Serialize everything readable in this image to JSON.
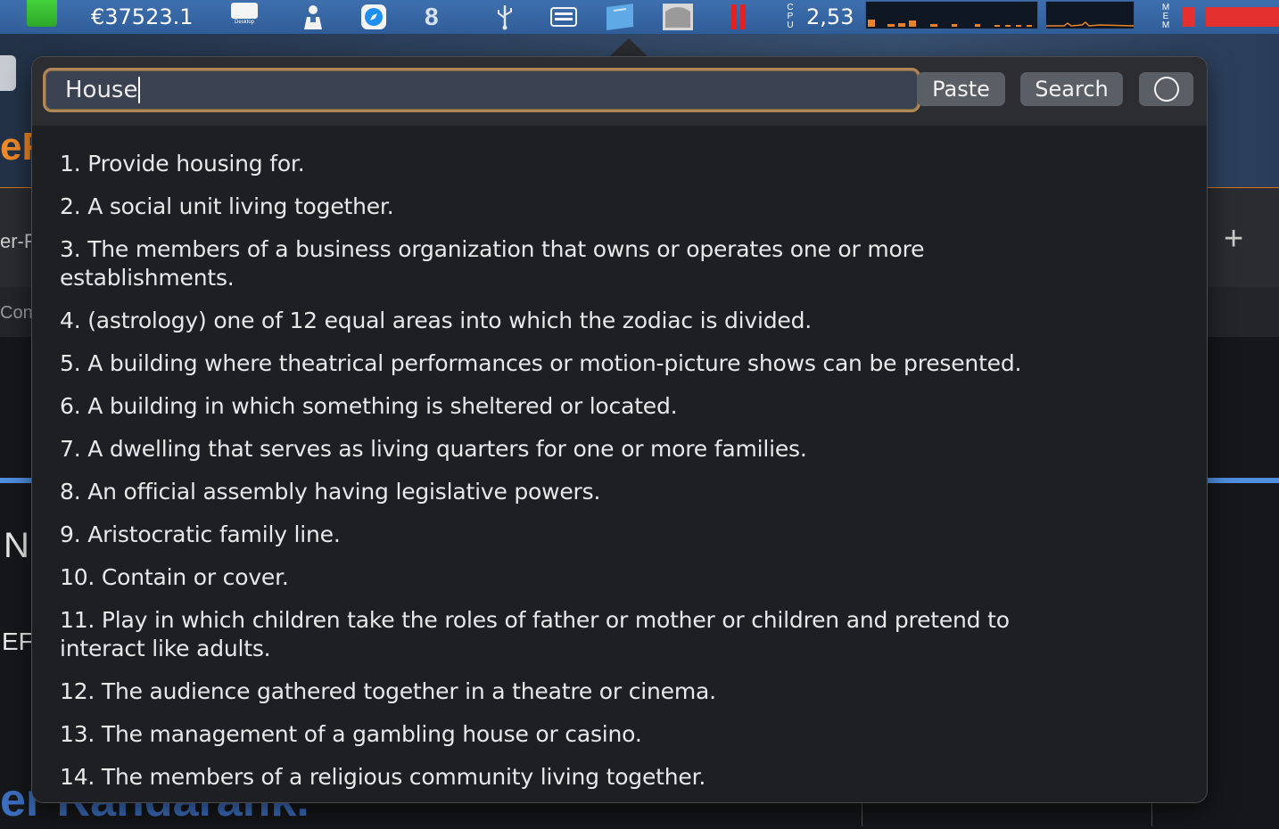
{
  "menubar": {
    "price": "€37523.1",
    "desktop_label": "Desktop",
    "cpu_label": [
      "C",
      "P",
      "U"
    ],
    "cpu_value": "2,53",
    "mem_label": [
      "M",
      "E",
      "M"
    ],
    "icons": [
      "battery-icon",
      "desktop-icon",
      "person-icon",
      "safari-icon",
      "eight-icon",
      "usb-icon",
      "keyboard-icon",
      "finder-icon",
      "disk-icon",
      "activity-bars-icon"
    ]
  },
  "background": {
    "left_e": "eF",
    "tab_fragment": "er-F",
    "con_fragment": "Con",
    "n_fragment": "N",
    "ep_fragment": "EF",
    "bottom_fragment": "er Randarank.",
    "plus": "+"
  },
  "popover": {
    "query": "House",
    "paste_label": "Paste",
    "search_label": "Search",
    "definitions": [
      "1. Provide housing for.",
      "2. A social unit living together.",
      "3. The members of a business organization that owns or operates one or more establishments.",
      "4. (astrology) one of 12 equal areas into which the zodiac is divided.",
      "5. A building where theatrical performances or motion-picture shows can be presented.",
      "6. A building in which something is sheltered or located.",
      "7. A dwelling that serves as living quarters for one or more families.",
      "8. An official assembly having legislative powers.",
      "9. Aristocratic family line.",
      "10. Contain or cover.",
      "11. Play in which children take the roles of father or mother or children and pretend to interact like adults.",
      "12. The audience gathered together in a theatre or cinema.",
      "13. The management of a gambling house or casino.",
      "14. The members of a religious community living together."
    ]
  },
  "colors": {
    "menubar": "#3e6fae",
    "input_border": "#b0875a",
    "button": "#5a5e65",
    "popover_bg": "#1e1f22",
    "accent_orange": "#f08a2a",
    "alert_red": "#e53030"
  }
}
